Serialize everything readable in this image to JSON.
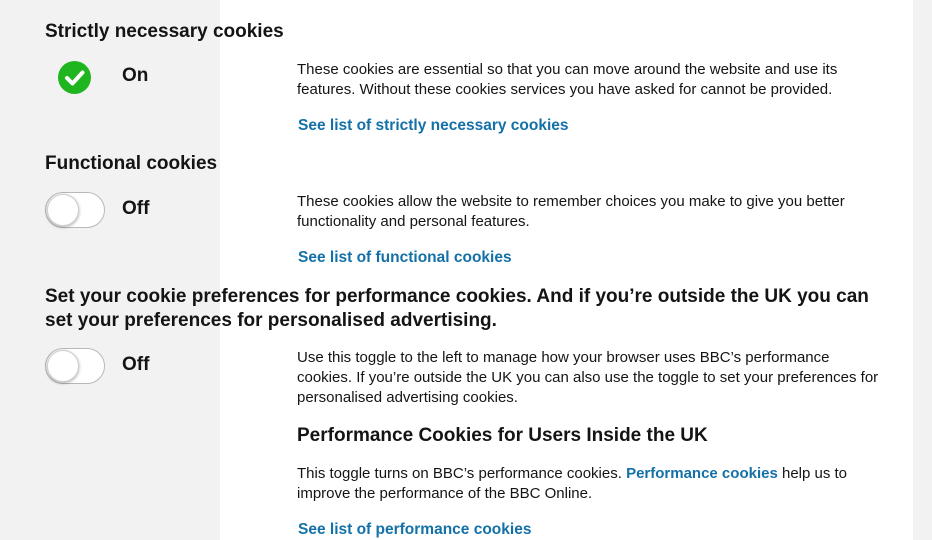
{
  "sections": {
    "strictly_necessary": {
      "title": "Strictly necessary cookies",
      "state_label": "On",
      "icon": "check-circle-icon",
      "description": "These cookies are essential so that you can move around the website and use its features. Without these cookies services you have asked for cannot be provided.",
      "link": "See list of strictly necessary cookies"
    },
    "functional": {
      "title": "Functional cookies",
      "state_label": "Off",
      "description": "These cookies allow the website to remember choices you make to give you better functionality and personal features.",
      "link": "See list of functional cookies"
    },
    "performance": {
      "title": "Set your cookie preferences for performance cookies. And if you’re outside the UK you can set your preferences for personalised advertising.",
      "state_label": "Off",
      "description": "Use this toggle to the left to manage how your browser uses BBC’s performance cookies. If you’re outside the UK you can also use the toggle to set your preferences for personalised advertising cookies.",
      "subheading": "Performance Cookies for Users Inside the UK",
      "uk_text_before": "This toggle turns on BBC’s performance cookies. ",
      "uk_inline_link": "Performance cookies",
      "uk_text_after": " help us to improve the performance of the BBC Online.",
      "link": "See list of performance cookies"
    }
  },
  "colors": {
    "link": "#1471a8",
    "check_green": "#1fb51f",
    "side_background": "#f2f2f2",
    "text": "#141414"
  }
}
